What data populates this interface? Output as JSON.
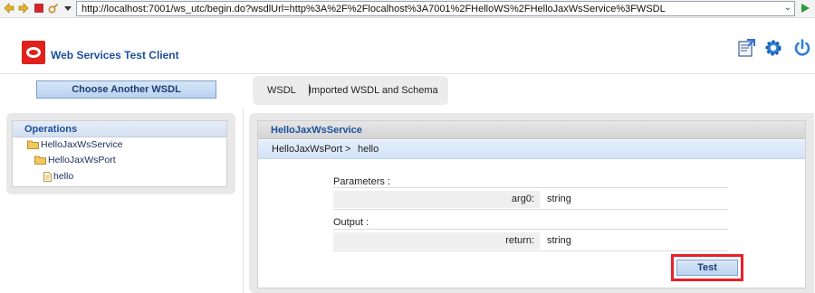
{
  "browser": {
    "url": "http://localhost:7001/ws_utc/begin.do?wsdlUrl=http%3A%2F%2Flocalhost%3A7001%2FHelloWS%2FHelloJaxWsService%3FWSDL",
    "icons": [
      "back-icon",
      "forward-icon",
      "stop-icon",
      "tools-icon",
      "dropdown-icon",
      "go-icon"
    ]
  },
  "header": {
    "title": "Web Services Test Client",
    "icons": [
      "import-icon",
      "settings-icon",
      "power-icon"
    ],
    "brand_color": "#e0201a",
    "title_color": "#1c4f9c"
  },
  "toolbar": {
    "choose_label": "Choose Another WSDL",
    "tabs": [
      {
        "label": "WSDL"
      },
      {
        "label": "Imported WSDL and Schema"
      }
    ]
  },
  "operations": {
    "title": "Operations",
    "tree": [
      {
        "label": "HelloJaxWsService",
        "icon": "folder-icon"
      },
      {
        "label": "HelloJaxWsPort",
        "icon": "folder-icon"
      },
      {
        "label": "hello",
        "icon": "file-icon"
      }
    ]
  },
  "service": {
    "title": "HelloJaxWsService",
    "breadcrumb": {
      "port": "HelloJaxWsPort",
      "separator": ">",
      "operation": "hello"
    },
    "parameters_label": "Parameters :",
    "parameters": [
      {
        "name": "arg0:",
        "type": "string"
      }
    ],
    "output_label": "Output :",
    "outputs": [
      {
        "name": "return:",
        "type": "string"
      }
    ],
    "test_label": "Test",
    "highlight_color": "#e8202a"
  }
}
